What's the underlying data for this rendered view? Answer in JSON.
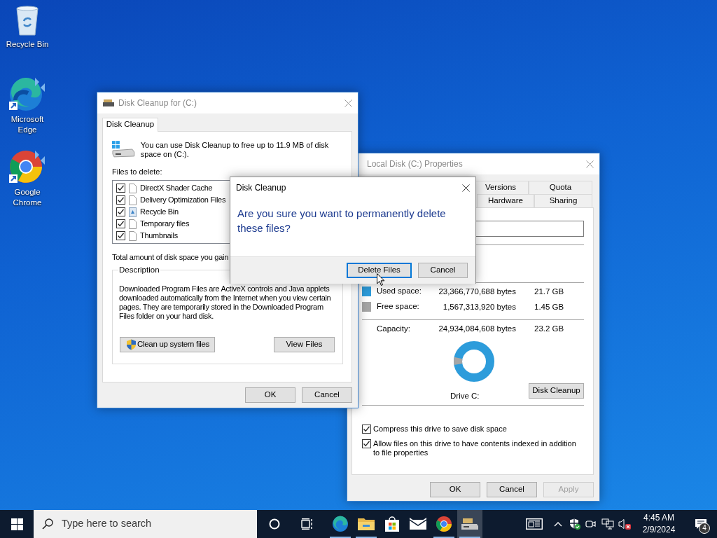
{
  "desktop_icons": [
    {
      "kind": "recycle",
      "label": "Recycle Bin"
    },
    {
      "kind": "edge",
      "label": "Microsoft Edge"
    },
    {
      "kind": "chrome",
      "label": "Google Chrome"
    }
  ],
  "properties_window": {
    "title": "Local Disk (C:) Properties",
    "tab_rows": [
      [
        {
          "label": "Versions",
          "selected": false
        },
        {
          "label": "Quota",
          "selected": false
        }
      ],
      [
        {
          "label": "Hardware",
          "selected": false
        },
        {
          "label": "Sharing",
          "selected": false
        }
      ]
    ],
    "space": [
      {
        "label": "Used space:",
        "bytes": "23,366,770,688 bytes",
        "size": "21.7 GB",
        "color": "#2d9cdb"
      },
      {
        "label": "Free space:",
        "bytes": "1,567,313,920 bytes",
        "size": "1.45 GB",
        "color": "#a6a6a6"
      }
    ],
    "capacity": {
      "label": "Capacity:",
      "bytes": "24,934,084,608 bytes",
      "size": "23.2 GB"
    },
    "drive_label": "Drive C:",
    "cleanup_button": "Disk Cleanup",
    "options": [
      {
        "label": "Compress this drive to save disk space",
        "checked": true
      },
      {
        "label": "Allow files on this drive to have contents indexed in addition to file properties",
        "checked": true
      }
    ],
    "buttons": [
      {
        "label": "OK",
        "disabled": false
      },
      {
        "label": "Cancel",
        "disabled": false
      },
      {
        "label": "Apply",
        "disabled": true
      }
    ]
  },
  "cleanup_window": {
    "title": "Disk Cleanup for  (C:)",
    "tab": {
      "label": "Disk Cleanup",
      "selected": true
    },
    "intro": "You can use Disk Cleanup to free up to 11.9 MB of disk space on  (C:).",
    "files_label": "Files to delete:",
    "files": [
      {
        "kind": "file",
        "label": "DirectX Shader Cache",
        "checked": true
      },
      {
        "kind": "file",
        "label": "Delivery Optimization Files",
        "checked": true
      },
      {
        "kind": "recycle",
        "label": "Recycle Bin",
        "checked": true
      },
      {
        "kind": "file",
        "label": "Temporary files",
        "checked": true
      },
      {
        "kind": "file",
        "label": "Thumbnails",
        "checked": true
      }
    ],
    "total_label": "Total amount of disk space you gain",
    "description_title": "Description",
    "description": "Downloaded Program Files are ActiveX controls and Java applets downloaded automatically from the Internet when you view certain pages. They are temporarily stored in the Downloaded Program Files folder on your hard disk.",
    "system_button": "Clean up system files",
    "view_button": "View Files",
    "buttons": [
      "OK",
      "Cancel"
    ]
  },
  "confirm_dialog": {
    "title": "Disk Cleanup",
    "message": "Are you sure you want to permanently delete these files?",
    "buttons": [
      {
        "label": "Delete Files",
        "default": true
      },
      {
        "label": "Cancel",
        "default": false
      }
    ]
  },
  "taskbar": {
    "search": {
      "placeholder": "Type here to search"
    },
    "apps": [
      {
        "kind": "edge",
        "running": true,
        "active": false
      },
      {
        "kind": "explorer",
        "running": true,
        "active": false
      },
      {
        "kind": "store",
        "running": false,
        "active": false
      },
      {
        "kind": "mail",
        "running": false,
        "active": false
      },
      {
        "kind": "chrome",
        "running": true,
        "active": false
      },
      {
        "kind": "cleanup",
        "running": true,
        "active": true
      }
    ],
    "clock": {
      "time": "4:45 AM",
      "date": "2/9/2024"
    },
    "notifications": "4"
  }
}
